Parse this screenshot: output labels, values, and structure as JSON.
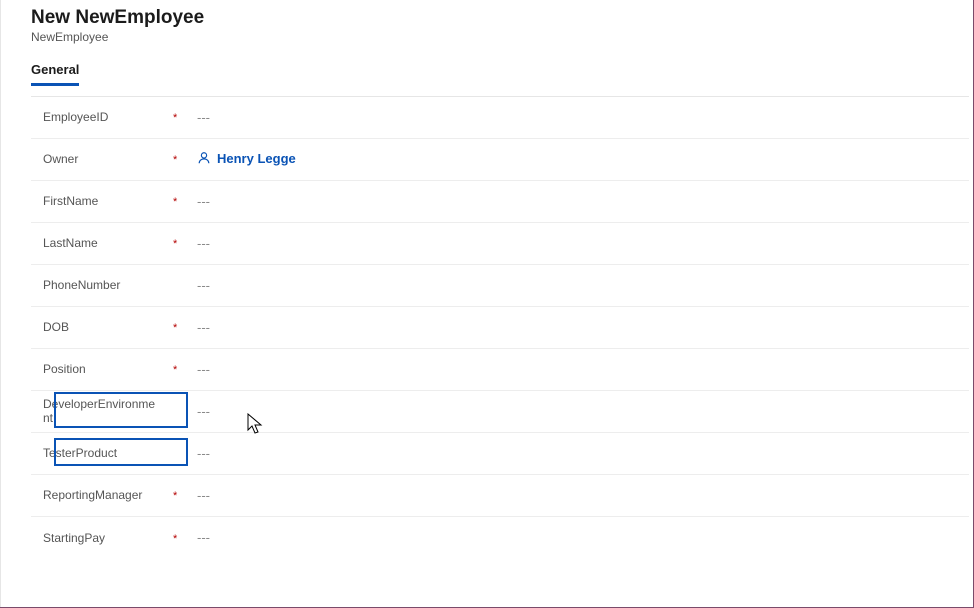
{
  "header": {
    "title": "New NewEmployee",
    "subtitle": "NewEmployee"
  },
  "tabs": {
    "general": "General"
  },
  "fields": {
    "employeeId": {
      "label": "EmployeeID",
      "required": "*",
      "value": "---"
    },
    "owner": {
      "label": "Owner",
      "required": "*",
      "value": "Henry Legge"
    },
    "firstName": {
      "label": "FirstName",
      "required": "*",
      "value": "---"
    },
    "lastName": {
      "label": "LastName",
      "required": "*",
      "value": "---"
    },
    "phoneNumber": {
      "label": "PhoneNumber",
      "required": "",
      "value": "---"
    },
    "dob": {
      "label": "DOB",
      "required": "*",
      "value": "---"
    },
    "position": {
      "label": "Position",
      "required": "*",
      "value": "---"
    },
    "devEnv": {
      "label": "DeveloperEnvironment",
      "required": "",
      "value": "---"
    },
    "testerProduct": {
      "label": "TesterProduct",
      "required": "",
      "value": "---"
    },
    "reportingMgr": {
      "label": "ReportingManager",
      "required": "*",
      "value": "---"
    },
    "startingPay": {
      "label": "StartingPay",
      "required": "*",
      "value": "---"
    }
  }
}
